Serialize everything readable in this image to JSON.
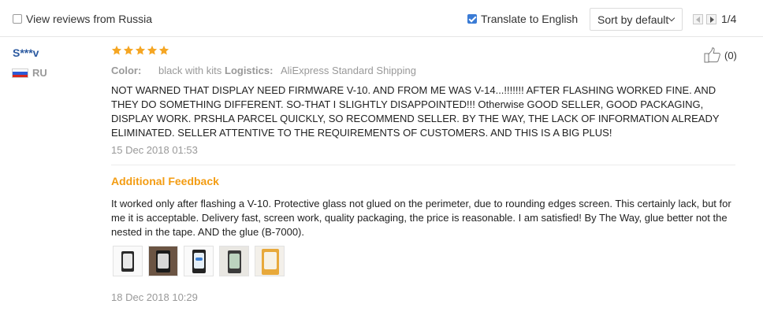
{
  "toolbar": {
    "view_reviews_label": "View reviews from Russia",
    "view_reviews_checked": false,
    "translate_label": "Translate to English",
    "translate_checked": true,
    "sort_label": "Sort by default",
    "page_indicator": "1/4"
  },
  "review": {
    "reviewer": "S***v",
    "country": "RU",
    "rating": 5,
    "likes": "(0)",
    "color_key": "Color:",
    "color_value": "black with kits",
    "logistics_key": "Logistics:",
    "logistics_value": "AliExpress Standard Shipping",
    "text": "NOT WARNED THAT DISPLAY NEED FIRMWARE V-10. AND FROM ME WAS V-14...!!!!!!! AFTER FLASHING WORKED FINE. AND THEY DO SOMETHING DIFFERENT. SO-THAT I SLIGHTLY DISAPPOINTED!!! Otherwise GOOD SELLER, GOOD PACKAGING, DISPLAY WORK. PRSHLA PARCEL QUICKLY, SO RECOMMEND SELLER. BY THE WAY, THE LACK OF INFORMATION ALREADY ELIMINATED. SELLER ATTENTIVE TO THE REQUIREMENTS OF CUSTOMERS. AND THIS IS A BIG PLUS!",
    "date": "15 Dec 2018 01:53",
    "additional": {
      "title": "Additional Feedback",
      "text": "It worked only after flashing a V-10. Protective glass not glued on the perimeter, due to rounding edges screen. This certainly lack, but for me it is acceptable. Delivery fast, screen work, quality packaging, the price is reasonable. I am satisfied! By The Way, glue better not the nested in the tape. AND the glue (B-7000).",
      "photo_count": 5,
      "date": "18 Dec 2018 10:29"
    }
  },
  "colors": {
    "star": "#f5a623",
    "reviewer_link": "#2c5aa0",
    "additional_title": "#f39c12",
    "checkbox_checked": "#3a7bd5"
  },
  "icons": {
    "like": "thumbs-up-icon",
    "flag": "russia-flag-icon",
    "star": "star-icon"
  }
}
